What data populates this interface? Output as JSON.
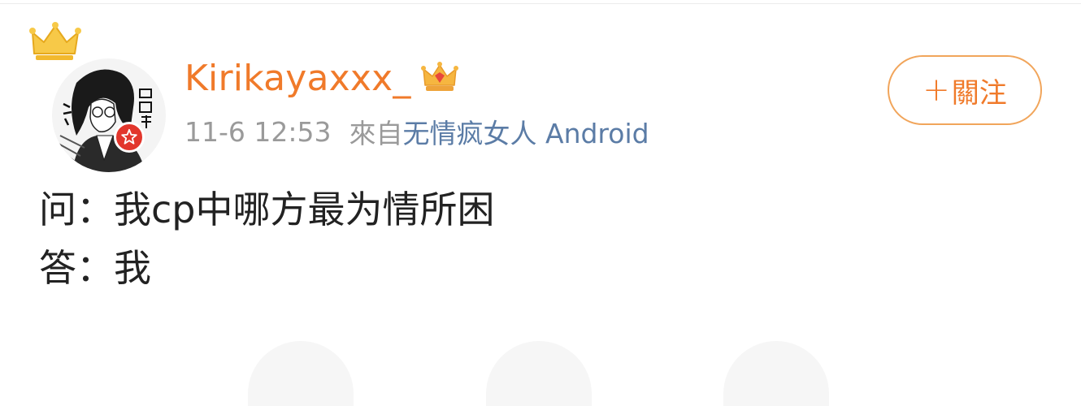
{
  "post": {
    "username": "Kirikayaxxx_",
    "timestamp": "11-6 12:53",
    "from_label": "來自",
    "source": "无情疯女人 Android",
    "follow_plus": "+",
    "follow_label": "關注",
    "content_line1": "问：我cp中哪方最为情所困",
    "content_line2": "答：我"
  },
  "colors": {
    "username": "#f07a2a",
    "source_link": "#5b7ca6",
    "meta_gray": "#9a9a9a",
    "follow_border": "#f1a55b",
    "badge_red": "#e2362c"
  },
  "icons": {
    "avatar_crown": "crown-icon",
    "verify_badge": "star-badge-icon",
    "vip": "vip-crown-icon"
  }
}
